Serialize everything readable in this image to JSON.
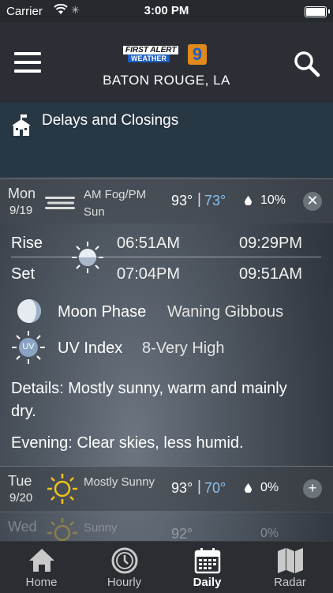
{
  "status_bar": {
    "carrier": "Carrier",
    "time": "3:00 PM"
  },
  "header": {
    "logo_line1": "FIRST ALERT",
    "logo_line2": "WEATHER",
    "logo_number": "9",
    "location": "BATON ROUGE, LA"
  },
  "delays": {
    "label": "Delays and Closings"
  },
  "days": [
    {
      "name": "Mon",
      "date": "9/19",
      "condition": "AM Fog/PM Sun",
      "high": "93°",
      "low": "73°",
      "precip": "10%",
      "icon": "fog-icon",
      "button": "✕"
    },
    {
      "name": "Tue",
      "date": "9/20",
      "condition": "Mostly Sunny",
      "high": "93°",
      "low": "70°",
      "precip": "0%",
      "icon": "sun-icon",
      "button": "+"
    },
    {
      "name": "Wed",
      "date": "",
      "condition": "Sunny",
      "high": "92°",
      "low": "",
      "precip": "0%",
      "icon": "sun-icon",
      "button": "+"
    }
  ],
  "detail": {
    "rise_label": "Rise",
    "set_label": "Set",
    "sunrise": "06:51AM",
    "sunset": "07:04PM",
    "moonrise": "09:29PM",
    "moonset": "09:51AM",
    "moon_phase_label": "Moon Phase",
    "moon_phase_value": "Waning Gibbous",
    "uv_label": "UV Index",
    "uv_value": "8-Very High",
    "uv_badge": "UV",
    "details_text": "Details: Mostly sunny, warm and mainly",
    "details_text2": "dry.",
    "evening_text": "Evening: Clear skies, less humid."
  },
  "tabs": [
    {
      "label": "Home",
      "icon": "home-icon"
    },
    {
      "label": "Hourly",
      "icon": "clock-icon"
    },
    {
      "label": "Daily",
      "icon": "calendar-icon",
      "active": true
    },
    {
      "label": "Radar",
      "icon": "map-icon"
    }
  ],
  "colors": {
    "accent_low_temp": "#8cc0ee",
    "delays_bg": "#283744",
    "tab_bar_bg": "#2a2d31"
  }
}
